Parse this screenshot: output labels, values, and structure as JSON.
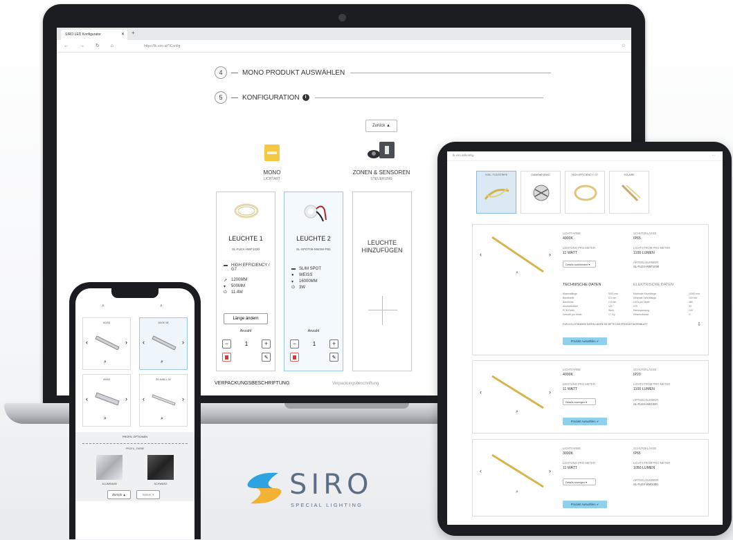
{
  "laptop": {
    "browser": {
      "tab_title": "SIRO LED Konfigurator",
      "url": "https://lk.siro.at/?Config",
      "nav_icons": "← → ↻ ⌂"
    },
    "steps": [
      {
        "num": "4",
        "label": "MONO PRODUKT AUSWÄHLEN"
      },
      {
        "num": "5",
        "label": "KONFIGURATION"
      }
    ],
    "back_button": "Zurück ▲",
    "types": [
      {
        "title": "MONO",
        "sub": "LICHTART"
      },
      {
        "title": "ZONEN & SENSOREN",
        "sub": "STEUERUNG"
      }
    ],
    "cards": [
      {
        "title": "LEUCHTE 1",
        "sku": "SL-FLEX-HWF1030",
        "specs": [
          "HIGH EFFICIENCY / G7",
          "1200MM",
          "500MM",
          "11.4W"
        ],
        "length_button": "Länge ändern",
        "qty_label": "Anzahl",
        "qty": "1"
      },
      {
        "title": "LEUCHTE 2",
        "sku": "SL-SPOT06-NW3W-PB1",
        "specs": [
          "SLIM SPOT",
          "WEISS",
          "16000MM",
          "3W"
        ],
        "qty_label": "Anzahl",
        "qty": "1"
      }
    ],
    "add_card": "LEUCHTE HINZUFÜGEN",
    "packaging_label": "VERPACKUNGSBESCHRIFTUNG",
    "packaging_placeholder": "Verpackungsbeschriftung"
  },
  "tablet": {
    "url": "lk.siro.at/konfig",
    "variants": [
      "COB - FLEXSTRIPE",
      "DIAMOND BAND",
      "HIGH EFFICIENCY / G7",
      "SOLAIRE"
    ],
    "products": [
      {
        "lichtfarbe_label": "LICHTFARBE",
        "lichtfarbe": "4000K",
        "schutz_label": "SCHUTZKLASSE",
        "schutz": "IP65",
        "leistung_label": "LEISTUNG PRO METER",
        "leistung": "11 WATT",
        "lumen_label": "LICHTSTROM PRO METER",
        "lumen": "1100 LUMEN",
        "details_button": "Details ausblenden ▾",
        "art_label": "ARTIKELNUMMER",
        "art": "SL-FLEX-HWF1030",
        "select_button": "Produkt Auswählen ✔"
      },
      {
        "lichtfarbe_label": "LICHTFARBE",
        "lichtfarbe": "4000K",
        "schutz_label": "SCHUTZKLASSE",
        "schutz": "IP20",
        "leistung_label": "LEISTUNG PRO METER",
        "leistung": "11 WATT",
        "lumen_label": "LICHTSTROM PRO METER",
        "lumen": "1100 LUMEN",
        "details_button": "Details anzeigen ▾",
        "art_label": "ARTIKELNUMMER",
        "art": "SL-FLEX-HW1020",
        "select_button": "Produkt Auswählen ✔"
      },
      {
        "lichtfarbe_label": "LICHTFARBE",
        "lichtfarbe": "3000K",
        "schutz_label": "SCHUTZKLASSE",
        "schutz": "IP65",
        "leistung_label": "LEISTUNG PRO METER",
        "leistung": "11 WATT",
        "lumen_label": "LICHTSTROM PRO METER",
        "lumen": "1050 LUMEN",
        "details_button": "Details anzeigen ▾",
        "art_label": "ARTIKELNUMMER",
        "art": "SL-FLEX-WW1030",
        "select_button": "Produkt Auswählen ✔"
      }
    ],
    "tech_title": "TECHNISCHE DATEN",
    "elec_title": "ELEKTRISCHE DATEN",
    "tech_rows": [
      [
        "Maximallänge",
        "5000 mm",
        "Maximale Einzellänge",
        "10000 mm"
      ],
      [
        "Bandbreite",
        "8.0 mm",
        "Minimale Schnittlänge",
        "100 mm"
      ],
      [
        "Bandhöhe",
        "1.6 mm",
        "LEDs pro Meter",
        "480"
      ],
      [
        "Abstrahlwinkel",
        "120 °",
        "CRI",
        "90"
      ],
      [
        "PCB-Farbe",
        "Weiß",
        "Nennspannung",
        "24V"
      ],
      [
        "Gewicht pro Meter",
        "17.5 g",
        "Effizienzklasse",
        "G"
      ]
    ],
    "download_note": "FÜR VOLLSTÄNDIGE DATEN LADEN SIE BITTE DAS PRODUKTDATENBLATT"
  },
  "phone": {
    "tiles": [
      "60/60",
      "60/30 W",
      "45/60",
      "30-WALL-W"
    ],
    "finish_title": "PROFIL OPTIONEN",
    "finish_sub": "PROFIL_FARBE",
    "finishes": [
      "ALUMINIUM",
      "SCHWARZ"
    ],
    "back_button": "Zurück ▲",
    "next_button": "Weiter ▾"
  },
  "logo": {
    "word": "SIRO",
    "tagline": "SPECIAL LIGHTING"
  },
  "colors": {
    "accent": "#8fd1ec",
    "brand": "#5c6d86",
    "logo_blue": "#2fa3e0",
    "logo_gold": "#f2b233"
  }
}
